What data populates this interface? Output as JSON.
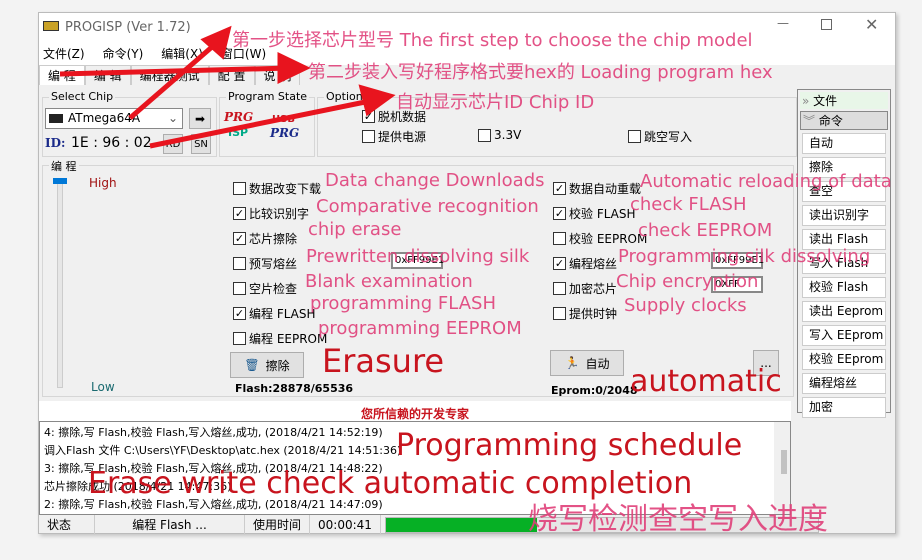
{
  "window": {
    "title": "PROGISP (Ver 1.72)",
    "controls": [
      "minimize",
      "maximize",
      "close"
    ]
  },
  "menu": [
    "文件(Z)",
    "命令(Y)",
    "编辑(X)",
    "窗口(W)"
  ],
  "tabs": [
    "编 程",
    "编 辑",
    "编程器测试",
    "配 置",
    "说 明"
  ],
  "select_chip": {
    "label": "Select Chip",
    "value": "ATmega64A",
    "id_label": "ID:",
    "id_value": "1E : 96 : 02",
    "rd": "RD",
    "sn": "SN"
  },
  "program_state": {
    "label": "Program State",
    "logo1": "PRG ISP",
    "logo2": "USB PRG"
  },
  "options": {
    "label": "Options",
    "items": [
      {
        "label": "脱机数据",
        "checked": true
      },
      {
        "label": "提供电源",
        "checked": false
      },
      {
        "label": "3.3V",
        "checked": false
      },
      {
        "label": "跳空写入",
        "checked": false
      }
    ]
  },
  "program": {
    "label": "编 程",
    "high": "High",
    "low": "Low",
    "slider_level": 1.0,
    "left": [
      {
        "label": "数据改变下载",
        "checked": false
      },
      {
        "label": "比较识别字",
        "checked": true
      },
      {
        "label": "芯片擦除",
        "checked": true
      },
      {
        "label": "预写熔丝",
        "checked": false
      },
      {
        "label": "空片检查",
        "checked": false
      },
      {
        "label": "编程 FLASH",
        "checked": true
      },
      {
        "label": "编程 EEPROM",
        "checked": false
      }
    ],
    "right": [
      {
        "label": "数据自动重载",
        "checked": true
      },
      {
        "label": "校验 FLASH",
        "checked": true
      },
      {
        "label": "校验 EEPROM",
        "checked": false
      },
      {
        "label": "编程熔丝",
        "checked": true
      },
      {
        "label": "加密芯片",
        "checked": false
      },
      {
        "label": "提供时钟",
        "checked": false
      }
    ],
    "prefuse": "0xFF99E1",
    "fuse": "0xFF99E1",
    "lock": "0XFF",
    "erase_btn": "擦除",
    "auto_btn": "自动",
    "more_btn": "...",
    "flash": "Flash:28878/65536",
    "eprom": "Eprom:0/2048"
  },
  "banner": "您所信赖的开发专家",
  "log": [
    "4: 擦除,写 Flash,校验 Flash,写入熔丝,成功, (2018/4/21 14:52:19)",
    "调入Flash 文件 C:\\Users\\YF\\Desktop\\atc.hex (2018/4/21 14:51:36)",
    "3: 擦除,写 Flash,校验 Flash,写入熔丝,成功, (2018/4/21 14:48:22)",
    "芯片擦除成功 (2018/4/21 14:47:36)",
    "2: 擦除,写 Flash,校验 Flash,写入熔丝,成功, (2018/4/21 14:47:09)"
  ],
  "side": {
    "file": "文件",
    "command": "命令",
    "buttons": [
      "自动",
      "擦除",
      "查空",
      "读出识别字",
      "读出 Flash",
      "写入 Flash",
      "校验 Flash",
      "读出 Eeprom",
      "写入 EEprom",
      "校验 EEprom",
      "编程熔丝",
      "加密"
    ]
  },
  "status": {
    "state_label": "状态",
    "state": "编程 Flash ...",
    "time_label": "使用时间",
    "time": "00:00:41",
    "progress": 0.35,
    "progress_color": "#06b025"
  },
  "annotations": {
    "step1": "第一步选择芯片型号 The first step to choose the chip model",
    "step2": "第二步装入写好程序格式要hex的 Loading program hex",
    "chipid": "自动显示芯片ID  Chip ID",
    "a1": "Data change Downloads",
    "a2": "Comparative recognition",
    "a3": "chip erase",
    "a4": "Prewritten dissolving silk",
    "a5": "Blank examination",
    "a6": "programming FLASH",
    "a7": "programming EEPROM",
    "b1": "Automatic reloading of data",
    "b2": "check FLASH",
    "b3": "check EEPROM",
    "b4": "Programming silk dissolving",
    "b5": "Chip encryption",
    "b6": "Supply clocks",
    "erasure": "Erasure",
    "automatic": "automatic",
    "schedule": "Programming schedule",
    "complete": "Erase write check automatic completion",
    "progress_cn": "烧写检测查空写入进度",
    "color": "#e0407a",
    "red": "#c8141e"
  }
}
